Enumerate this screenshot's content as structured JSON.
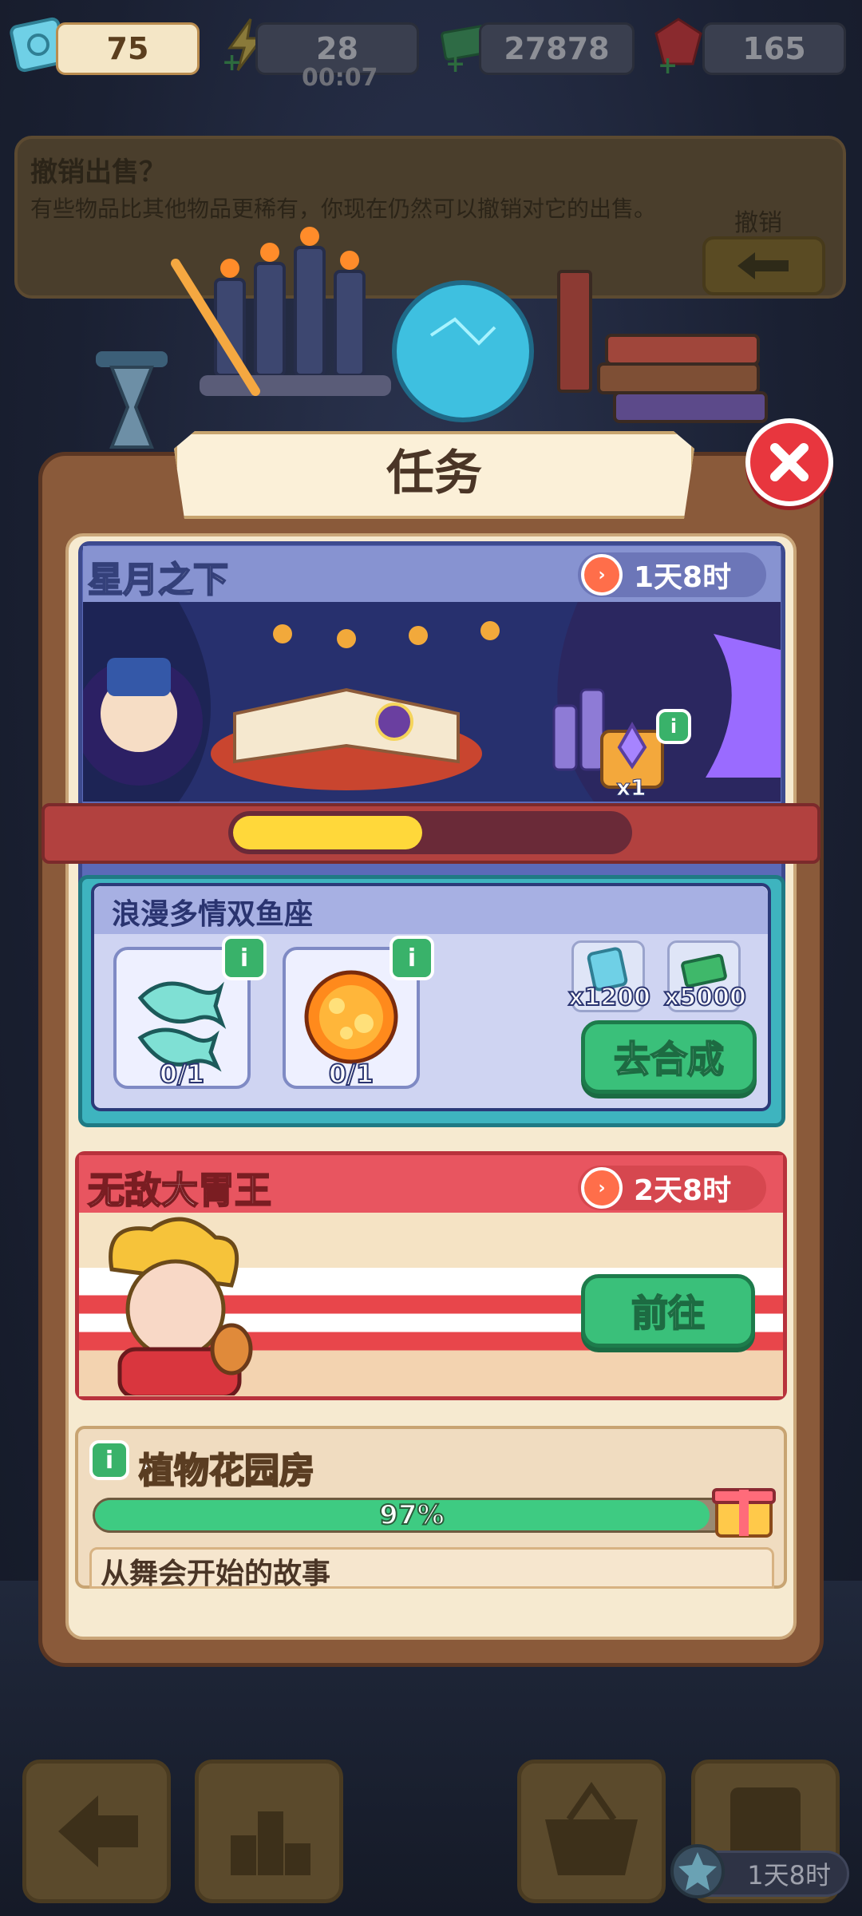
{
  "resources": {
    "tickets": "75",
    "energy": "28",
    "energy_timer": "00:07",
    "cash": "27878",
    "gems": "165"
  },
  "undo": {
    "title": "撤销出售？",
    "description": "有些物品比其他物品更稀有，你现在仍然可以撤销对它的出售。",
    "button_label": "撤销"
  },
  "window": {
    "title": "任务"
  },
  "event1": {
    "title": "星月之下",
    "timer": "1天8时",
    "reward_box_qty": "x1",
    "progress": 0.48,
    "task": {
      "title": "浪漫多情双鱼座",
      "items": [
        {
          "name": "pisces",
          "count": "0/1"
        },
        {
          "name": "sun",
          "count": "0/1"
        }
      ],
      "rewards": [
        {
          "name": "ticket",
          "count": "x1200"
        },
        {
          "name": "cash",
          "count": "x5000"
        }
      ],
      "action": "去合成"
    }
  },
  "event2": {
    "title": "无敌大胃王",
    "timer": "2天8时",
    "action": "前往"
  },
  "event3": {
    "title": "植物花园房",
    "progress_text": "97%",
    "progress": 0.97,
    "next_title": "从舞会开始的故事"
  },
  "bottom": {
    "timer": "1天8时"
  },
  "colors": {
    "accent_green": "#3ac07a",
    "close_red": "#e8363e",
    "event1_blue": "#5b6ab8",
    "event2_red": "#e85560"
  }
}
